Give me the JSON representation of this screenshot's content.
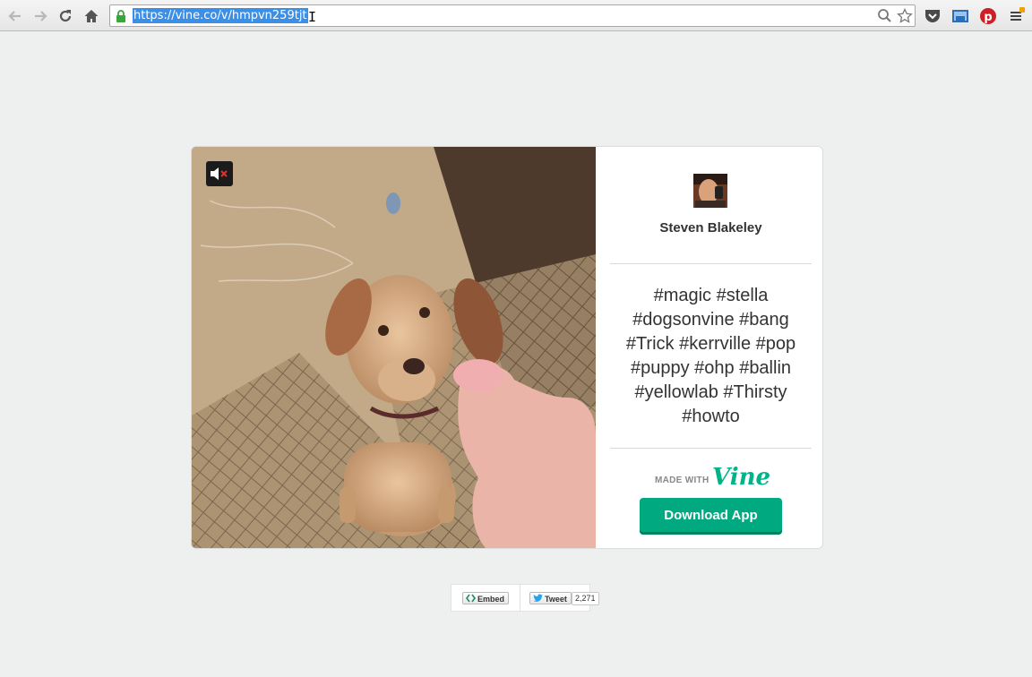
{
  "browser": {
    "url": "https://vine.co/v/hmpvn259tjt"
  },
  "post": {
    "author": "Steven Blakeley",
    "description": "#magic #stella #dogsonvine #bang #Trick #kerrville #pop #puppy #ohp #ballin #yellowlab #Thirsty #howto",
    "made_with": "MADE WITH",
    "brand": "Vine",
    "download_label": "Download App",
    "muted": true
  },
  "share": {
    "embed_label": "Embed",
    "tweet_label": "Tweet",
    "tweet_count": "2,271"
  },
  "colors": {
    "brand": "#00b489",
    "button": "#00a980",
    "background": "#eef0ef"
  },
  "icons": [
    "back-arrow-icon",
    "forward-arrow-icon",
    "reload-icon",
    "home-icon",
    "lock-icon",
    "search-icon",
    "star-icon",
    "pocket-icon",
    "screenshot-icon",
    "pinterest-icon",
    "menu-icon",
    "mute-icon"
  ]
}
